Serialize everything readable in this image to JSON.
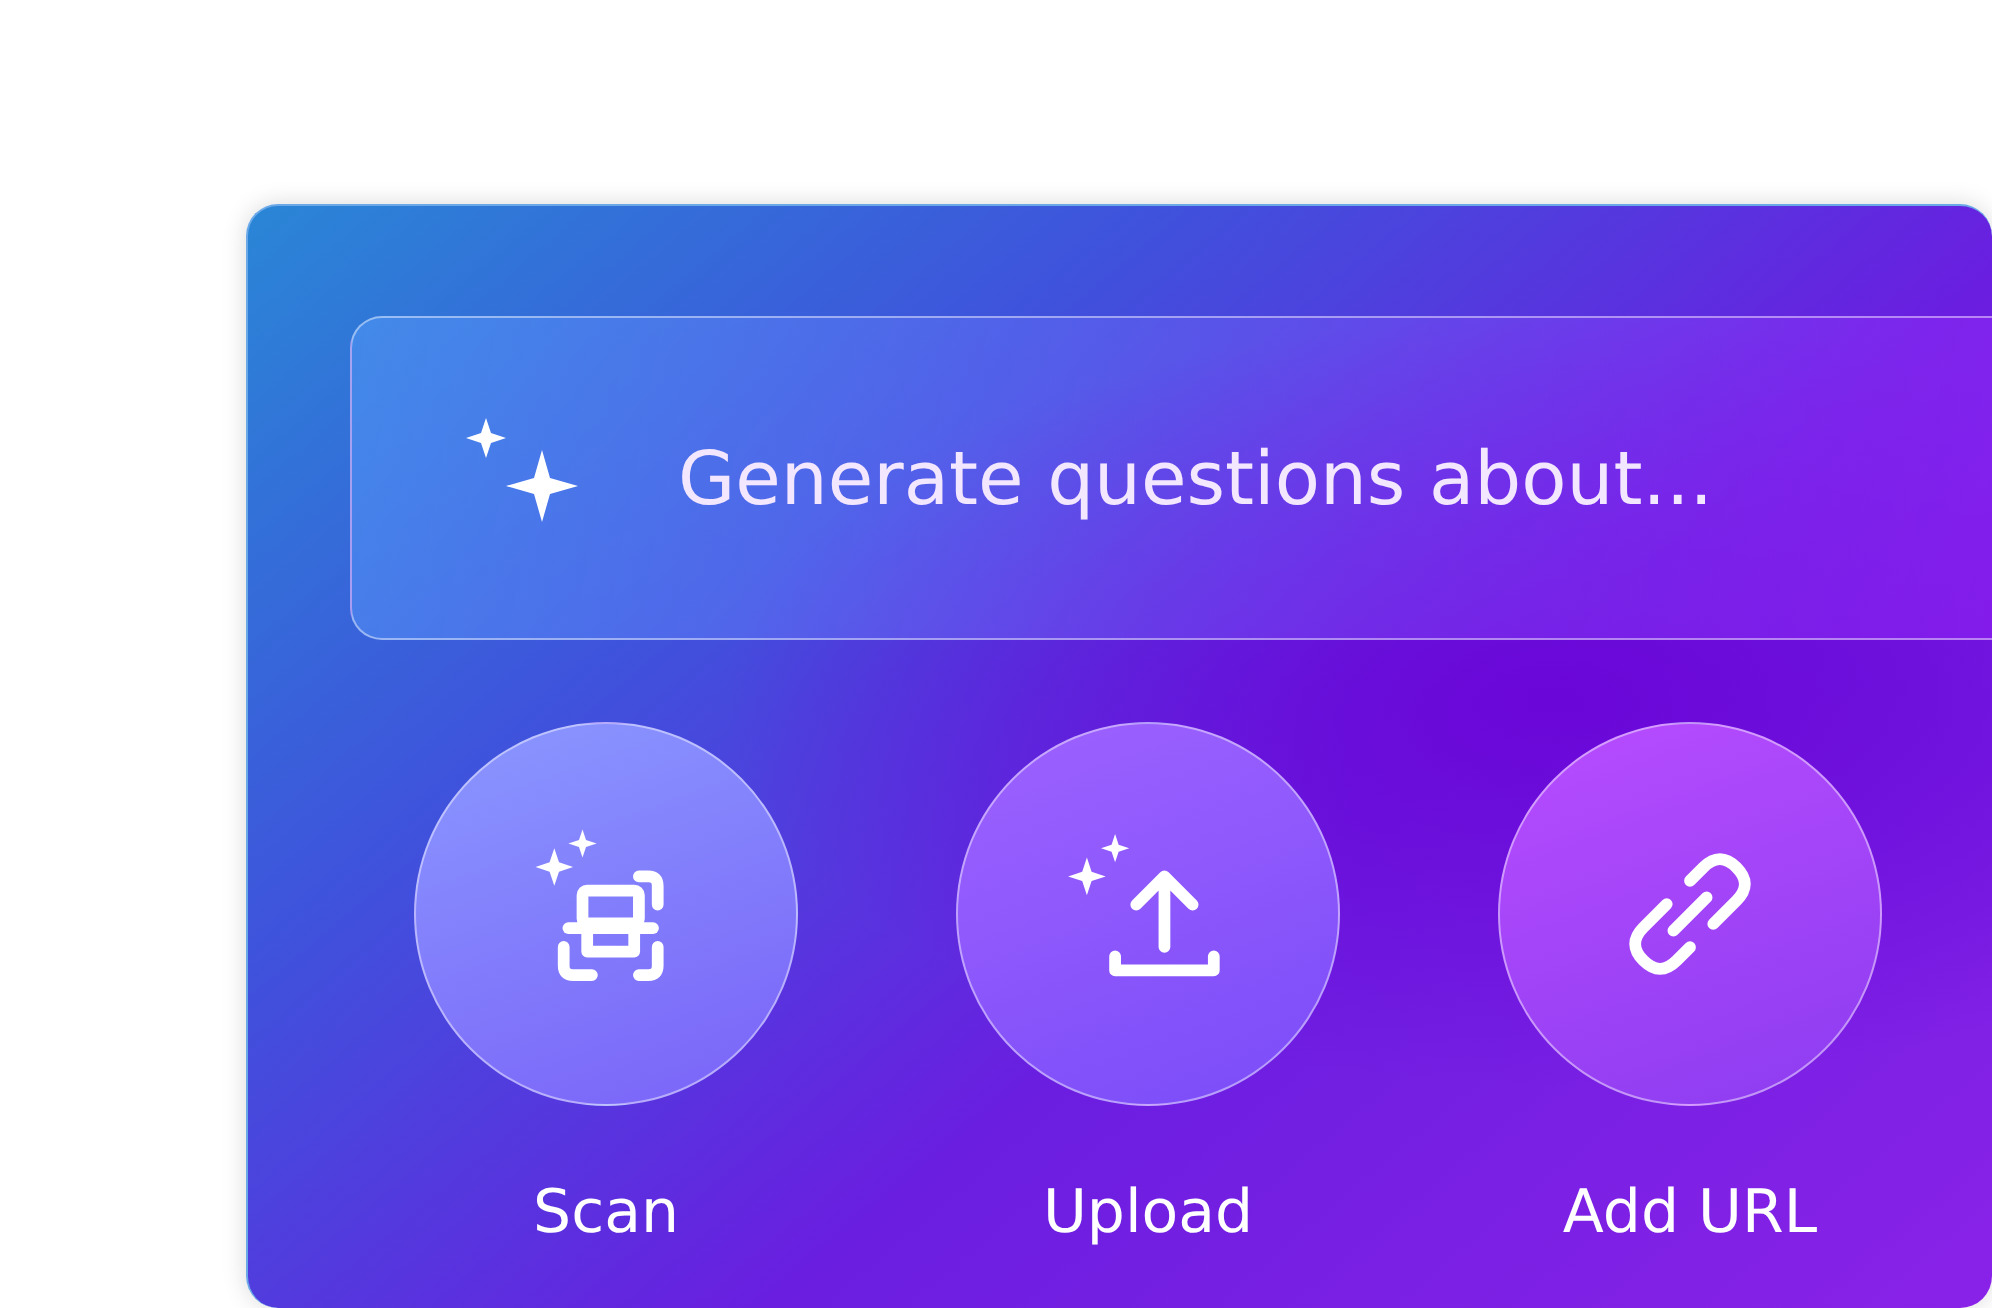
{
  "prompt": {
    "placeholder": "Generate questions about..."
  },
  "actions": [
    {
      "kind": "scan",
      "label": "Scan"
    },
    {
      "kind": "upload",
      "label": "Upload"
    },
    {
      "kind": "link",
      "label": "Add URL"
    }
  ]
}
